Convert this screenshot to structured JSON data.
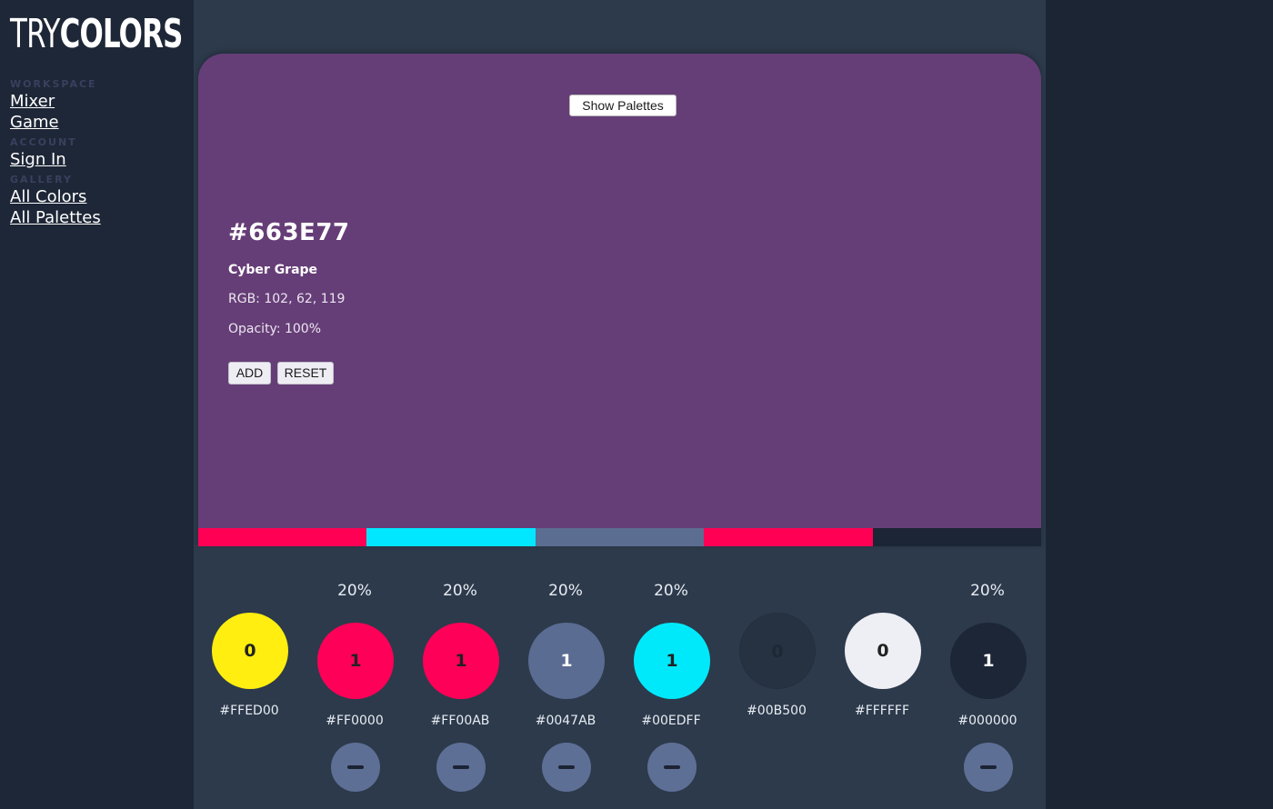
{
  "logo": {
    "part1": "TRY",
    "part2": "COLORS"
  },
  "nav": {
    "workspace_label": "WORKSPACE",
    "mixer": "Mixer",
    "game": "Game",
    "account_label": "ACCOUNT",
    "sign_in": "Sign In",
    "gallery_label": "GALLERY",
    "all_colors": "All Colors",
    "all_palettes": "All Palettes"
  },
  "card": {
    "show_palettes": "Show Palettes",
    "hex": "#663E77",
    "name": "Cyber Grape",
    "rgb": "RGB: 102, 62, 119",
    "opacity": "Opacity: 100%",
    "add_label": "ADD",
    "reset_label": "RESET",
    "background": "#663e77"
  },
  "mix_bar": [
    "#ff0055",
    "#00e7ff",
    "#5c6d92",
    "#ff0055",
    "#1c2535"
  ],
  "swatches": [
    {
      "pct": "",
      "count": "0",
      "hex": "#FFED00",
      "fill": "#ffee0f",
      "text_color": "#222222",
      "active": false
    },
    {
      "pct": "20%",
      "count": "1",
      "hex": "#FF0000",
      "fill": "#ff0058",
      "text_color": "#222222",
      "active": true
    },
    {
      "pct": "20%",
      "count": "1",
      "hex": "#FF00AB",
      "fill": "#ff0058",
      "text_color": "#222222",
      "active": true
    },
    {
      "pct": "20%",
      "count": "1",
      "hex": "#0047AB",
      "fill": "#5b6c93",
      "text_color": "#ffffff",
      "active": true
    },
    {
      "pct": "20%",
      "count": "1",
      "hex": "#00EDFF",
      "fill": "#00e9fb",
      "text_color": "#222222",
      "active": true
    },
    {
      "pct": "",
      "count": "0",
      "hex": "#00B500",
      "fill": "#263241",
      "text_color": "#1d2736",
      "active": false
    },
    {
      "pct": "",
      "count": "0",
      "hex": "#FFFFFF",
      "fill": "#eeeef5",
      "text_color": "#222222",
      "active": false
    },
    {
      "pct": "20%",
      "count": "1",
      "hex": "#000000",
      "fill": "#1c2636",
      "text_color": "#ffffff",
      "active": true
    }
  ]
}
